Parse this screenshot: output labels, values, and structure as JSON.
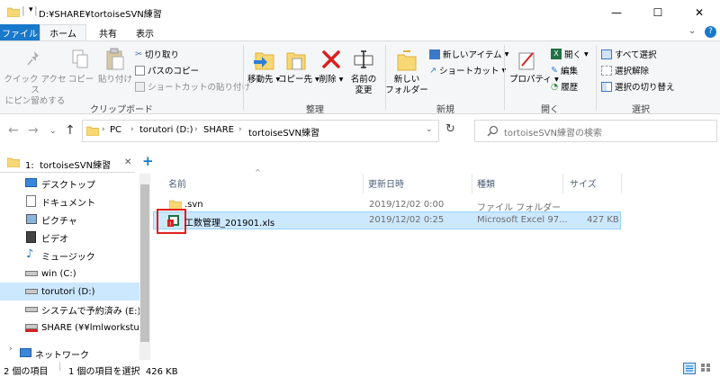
{
  "window": {
    "title": "D:¥SHARE¥tortoiseSVN練習",
    "minimize": "—",
    "maximize": "☐",
    "close": "✕"
  },
  "menu": {
    "tabs": [
      "ファイル",
      "ホーム",
      "共有",
      "表示"
    ],
    "expand": "⌄",
    "help": "?"
  },
  "ribbon": {
    "clipboard": {
      "label": "クリップボード",
      "pin": "クイック アクセス\nにピン留めする",
      "copy": "コピー",
      "paste": "貼り付け",
      "cut": "切り取り",
      "copy_path": "パスのコピー",
      "paste_shortcut": "ショートカットの貼り付け"
    },
    "organize": {
      "label": "整理",
      "move_to": "移動先",
      "copy_to": "コピー先",
      "delete": "削除",
      "rename": "名前の\n変更"
    },
    "new": {
      "label": "新規",
      "new_folder": "新しい\nフォルダー",
      "new_item": "新しいアイテム",
      "shortcut": "ショートカット"
    },
    "open": {
      "label": "開く",
      "properties": "プロパティ",
      "open": "開く",
      "edit": "編集",
      "history": "履歴"
    },
    "select": {
      "label": "選択",
      "select_all": "すべて選択",
      "select_none": "選択解除",
      "invert": "選択の切り替え"
    }
  },
  "address": {
    "crumbs": [
      "PC",
      "torutori (D:)",
      "SHARE",
      "tortoiseSVN練習"
    ],
    "search_placeholder": "tortoiseSVN練習の検索"
  },
  "sidebar": {
    "quick_tab": "1:  tortoiseSVN練習",
    "add": "+",
    "items": [
      {
        "label": "デスクトップ",
        "icon": "desktop-icon"
      },
      {
        "label": "ドキュメント",
        "icon": "document-icon"
      },
      {
        "label": "ピクチャ",
        "icon": "picture-icon"
      },
      {
        "label": "ビデオ",
        "icon": "video-icon"
      },
      {
        "label": "ミュージック",
        "icon": "music-icon"
      },
      {
        "label": "win (C:)",
        "icon": "drive-icon"
      },
      {
        "label": "torutori (D:)",
        "icon": "drive-icon",
        "selected": true
      },
      {
        "label": "システムで予約済み (E:)",
        "icon": "drive-icon"
      },
      {
        "label": "SHARE (¥¥lmlworkstud)",
        "icon": "network-drive-icon"
      },
      {
        "label": "ネットワーク",
        "icon": "network-icon"
      }
    ]
  },
  "columns": [
    "名前",
    "更新日時",
    "種類",
    "サイズ"
  ],
  "files": [
    {
      "name": ".svn",
      "modified": "2019/12/02 0:00",
      "type": "ファイル フォルダー",
      "size": "",
      "icon": "folder-icon"
    },
    {
      "name": "工数管理_201901.xls",
      "modified": "2019/12/02 0:25",
      "type": "Microsoft Excel 97...",
      "size": "427 KB",
      "icon": "excel-svn-modified-icon",
      "selected": true
    }
  ],
  "status": {
    "count": "2 個の項目",
    "selected": "1 個の項目を選択  426 KB"
  },
  "colors": {
    "accent": "#1979ca",
    "selection": "#cce8ff",
    "highlight_box": "#e0201b"
  }
}
